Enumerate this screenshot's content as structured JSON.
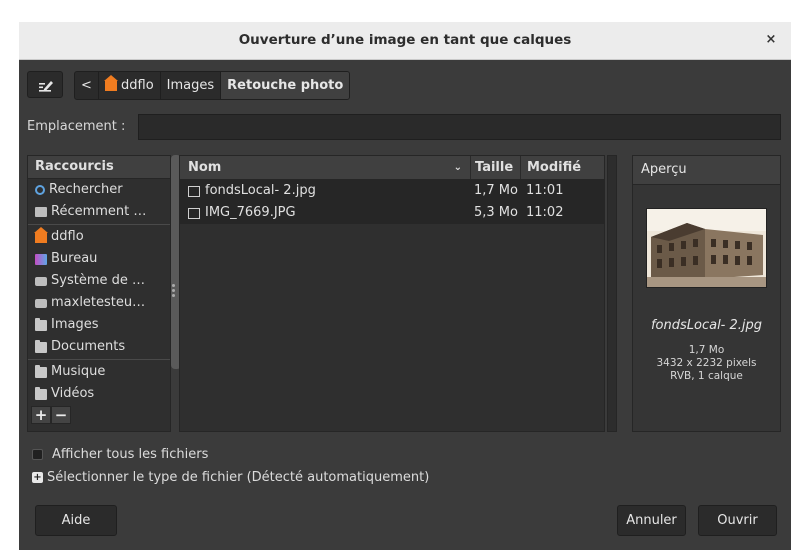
{
  "window": {
    "title": "Ouverture d’une image en tant que calques",
    "close_label": "×"
  },
  "pathbar": {
    "back_label": "<",
    "crumbs": [
      "ddflo",
      "Images",
      "Retouche photo"
    ]
  },
  "location": {
    "label": "Emplacement :",
    "value": ""
  },
  "sidebar": {
    "header": "Raccourcis",
    "items": [
      {
        "label": "Rechercher",
        "icon": "search-icon"
      },
      {
        "label": "Récemment …",
        "icon": "recent-icon"
      },
      {
        "label": "ddflo",
        "icon": "home-icon"
      },
      {
        "label": "Bureau",
        "icon": "desktop-icon"
      },
      {
        "label": "Système de …",
        "icon": "drive-icon"
      },
      {
        "label": "maxletesteu…",
        "icon": "drive-icon"
      },
      {
        "label": "Images",
        "icon": "folder-icon"
      },
      {
        "label": "Documents",
        "icon": "folder-icon"
      },
      {
        "label": "Musique",
        "icon": "folder-icon"
      },
      {
        "label": "Vidéos",
        "icon": "folder-icon"
      }
    ],
    "add_label": "+",
    "remove_label": "−"
  },
  "filelist": {
    "columns": {
      "name": "Nom",
      "size": "Taille",
      "modified": "Modifié"
    },
    "rows": [
      {
        "name": "fondsLocal- 2.jpg",
        "size": "1,7 Mo",
        "modified": "11:01"
      },
      {
        "name": "IMG_7669.JPG",
        "size": "5,3 Mo",
        "modified": "11:02"
      }
    ]
  },
  "preview": {
    "header": "Aperçu",
    "filename": "fondsLocal- 2.jpg",
    "size": "1,7 Mo",
    "dimensions": "3432 x 2232 pixels",
    "mode": "RVB, 1 calque"
  },
  "options": {
    "show_all_files": "Afficher tous les fichiers",
    "select_file_type": "Sélectionner le type de fichier (Détecté automatiquement)"
  },
  "buttons": {
    "help": "Aide",
    "cancel": "Annuler",
    "open": "Ouvrir"
  },
  "colors": {
    "background": "#3b3b3b",
    "titlebar": "#ececec",
    "selected_row": "#262626",
    "home_accent": "#f07c20"
  }
}
